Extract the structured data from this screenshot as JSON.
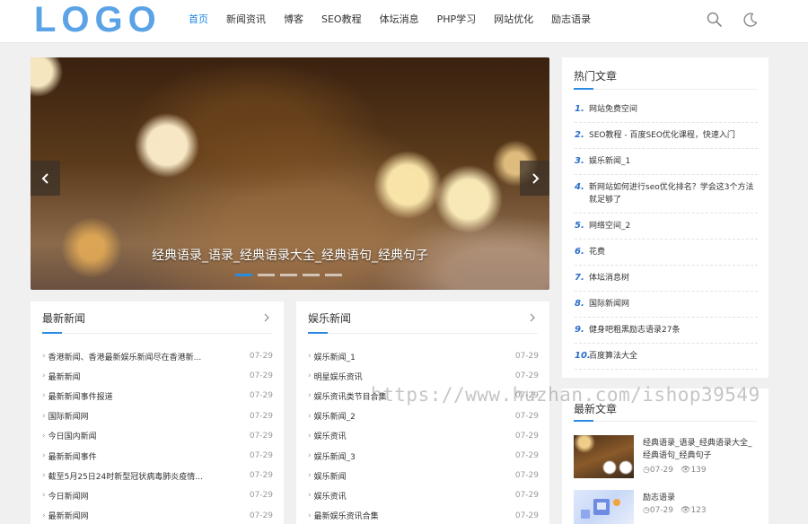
{
  "header": {
    "logo": "LOGO",
    "nav": [
      "首页",
      "新闻资讯",
      "博客",
      "SEO教程",
      "体坛消息",
      "PHP学习",
      "网站优化",
      "励志语录"
    ],
    "icons": [
      "search-icon",
      "moon-icon"
    ]
  },
  "slider": {
    "caption": "经典语录_语录_经典语录大全_经典语句_经典句子",
    "dots": 5,
    "active_dot": 1
  },
  "latest_news": {
    "title": "最新新闻",
    "items": [
      {
        "title": "香港新闻、香港最新娱乐新闻尽在香港新...",
        "date": "07-29"
      },
      {
        "title": "最新新闻",
        "date": "07-29"
      },
      {
        "title": "最新新闻事件报道",
        "date": "07-29"
      },
      {
        "title": "国际新闻网",
        "date": "07-29"
      },
      {
        "title": "今日国内新闻",
        "date": "07-29"
      },
      {
        "title": "最新新闻事件",
        "date": "07-29"
      },
      {
        "title": "截至5月25日24时新型冠状病毒肺炎疫情...",
        "date": "07-29"
      },
      {
        "title": "今日新闻网",
        "date": "07-29"
      },
      {
        "title": "最新新闻网",
        "date": "07-29"
      }
    ]
  },
  "ent_news": {
    "title": "娱乐新闻",
    "items": [
      {
        "title": "娱乐新闻_1",
        "date": "07-29"
      },
      {
        "title": "明星娱乐资讯",
        "date": "07-29"
      },
      {
        "title": "娱乐资讯类节目合集",
        "date": "07-29"
      },
      {
        "title": "娱乐新闻_2",
        "date": "07-29"
      },
      {
        "title": "娱乐资讯",
        "date": "07-29"
      },
      {
        "title": "娱乐新闻_3",
        "date": "07-29"
      },
      {
        "title": "娱乐新闻",
        "date": "07-29"
      },
      {
        "title": "娱乐资讯",
        "date": "07-29"
      },
      {
        "title": "最新娱乐资讯合集",
        "date": "07-29"
      }
    ]
  },
  "hot": {
    "title": "热门文章",
    "items": [
      {
        "n": "1.",
        "title": "网站免费空间"
      },
      {
        "n": "2.",
        "title": "SEO教程 - 百度SEO优化课程，快速入门"
      },
      {
        "n": "3.",
        "title": "娱乐新闻_1"
      },
      {
        "n": "4.",
        "title": "新网站如何进行seo优化排名？学会这3个方法就足够了"
      },
      {
        "n": "5.",
        "title": "网络空间_2"
      },
      {
        "n": "6.",
        "title": "花费"
      },
      {
        "n": "7.",
        "title": "体坛消息树"
      },
      {
        "n": "8.",
        "title": "国际新闻网"
      },
      {
        "n": "9.",
        "title": "健身吧粗黑励志语录27条"
      },
      {
        "n": "10.",
        "title": "百度算法大全"
      }
    ]
  },
  "latest_articles": {
    "title": "最新文章",
    "items": [
      {
        "title": "经典语录_语录_经典语录大全_经典语句_经典句子",
        "date": "07-29",
        "views": "139"
      },
      {
        "title": "励志语录",
        "date": "07-29",
        "views": "123"
      }
    ]
  },
  "watermark": "https://www.huzhan.com/ishop39549"
}
